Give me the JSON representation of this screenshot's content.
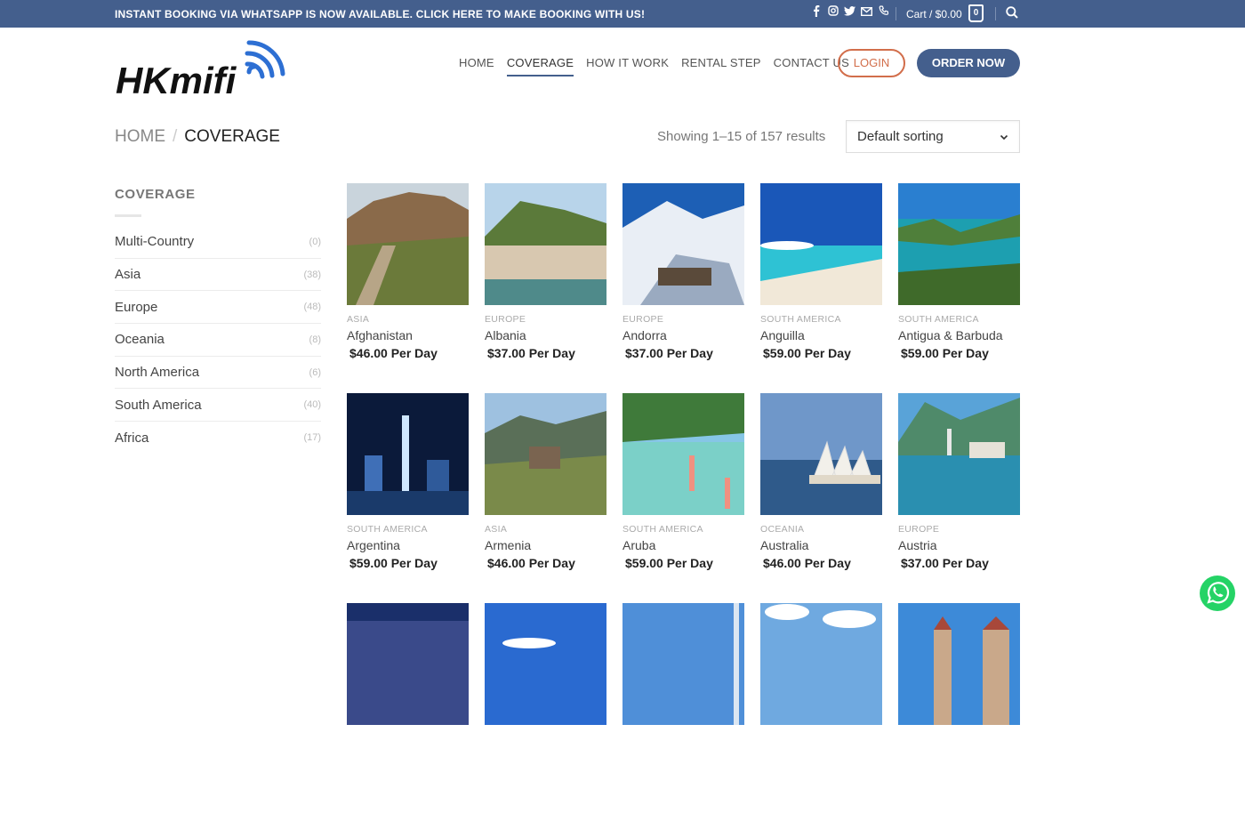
{
  "topbar": {
    "promo": "INSTANT BOOKING VIA WHATSAPP IS NOW AVAILABLE. CLICK HERE TO MAKE BOOKING WITH US!",
    "social_icons": [
      "facebook-icon",
      "instagram-icon",
      "twitter-icon",
      "email-icon",
      "phone-icon"
    ],
    "cart_label": "Cart / $0.00",
    "cart_count": "0"
  },
  "header": {
    "logo_text": "HKmifi",
    "nav": [
      "HOME",
      "COVERAGE",
      "HOW IT WORK",
      "RENTAL STEP",
      "CONTACT US"
    ],
    "active_nav": "COVERAGE",
    "login_label": "LOGIN",
    "order_label": "ORDER NOW"
  },
  "page": {
    "breadcrumb_home": "HOME",
    "breadcrumb_sep": "/",
    "breadcrumb_current": "COVERAGE",
    "results_text": "Showing 1–15 of 157 results",
    "sort_value": "Default sorting"
  },
  "sidebar": {
    "title": "COVERAGE",
    "items": [
      {
        "label": "Multi-Country",
        "count": "(0)"
      },
      {
        "label": "Asia",
        "count": "(38)"
      },
      {
        "label": "Europe",
        "count": "(48)"
      },
      {
        "label": "Oceania",
        "count": "(8)"
      },
      {
        "label": "North America",
        "count": "(6)"
      },
      {
        "label": "South America",
        "count": "(40)"
      },
      {
        "label": "Africa",
        "count": "(17)"
      }
    ]
  },
  "products": [
    {
      "cat": "ASIA",
      "name": "Afghanistan",
      "price": "$46.00 Per Day"
    },
    {
      "cat": "EUROPE",
      "name": "Albania",
      "price": "$37.00 Per Day"
    },
    {
      "cat": "EUROPE",
      "name": "Andorra",
      "price": "$37.00 Per Day"
    },
    {
      "cat": "SOUTH AMERICA",
      "name": "Anguilla",
      "price": "$59.00 Per Day"
    },
    {
      "cat": "SOUTH AMERICA",
      "name": "Antigua & Barbuda",
      "price": "$59.00 Per Day"
    },
    {
      "cat": "SOUTH AMERICA",
      "name": "Argentina",
      "price": "$59.00 Per Day"
    },
    {
      "cat": "ASIA",
      "name": "Armenia",
      "price": "$46.00 Per Day"
    },
    {
      "cat": "SOUTH AMERICA",
      "name": "Aruba",
      "price": "$59.00 Per Day"
    },
    {
      "cat": "OCEANIA",
      "name": "Australia",
      "price": "$46.00 Per Day"
    },
    {
      "cat": "EUROPE",
      "name": "Austria",
      "price": "$37.00 Per Day"
    }
  ],
  "colors": {
    "brand": "#445f8d",
    "accent": "#d26e4b",
    "whatsapp": "#25d366"
  }
}
